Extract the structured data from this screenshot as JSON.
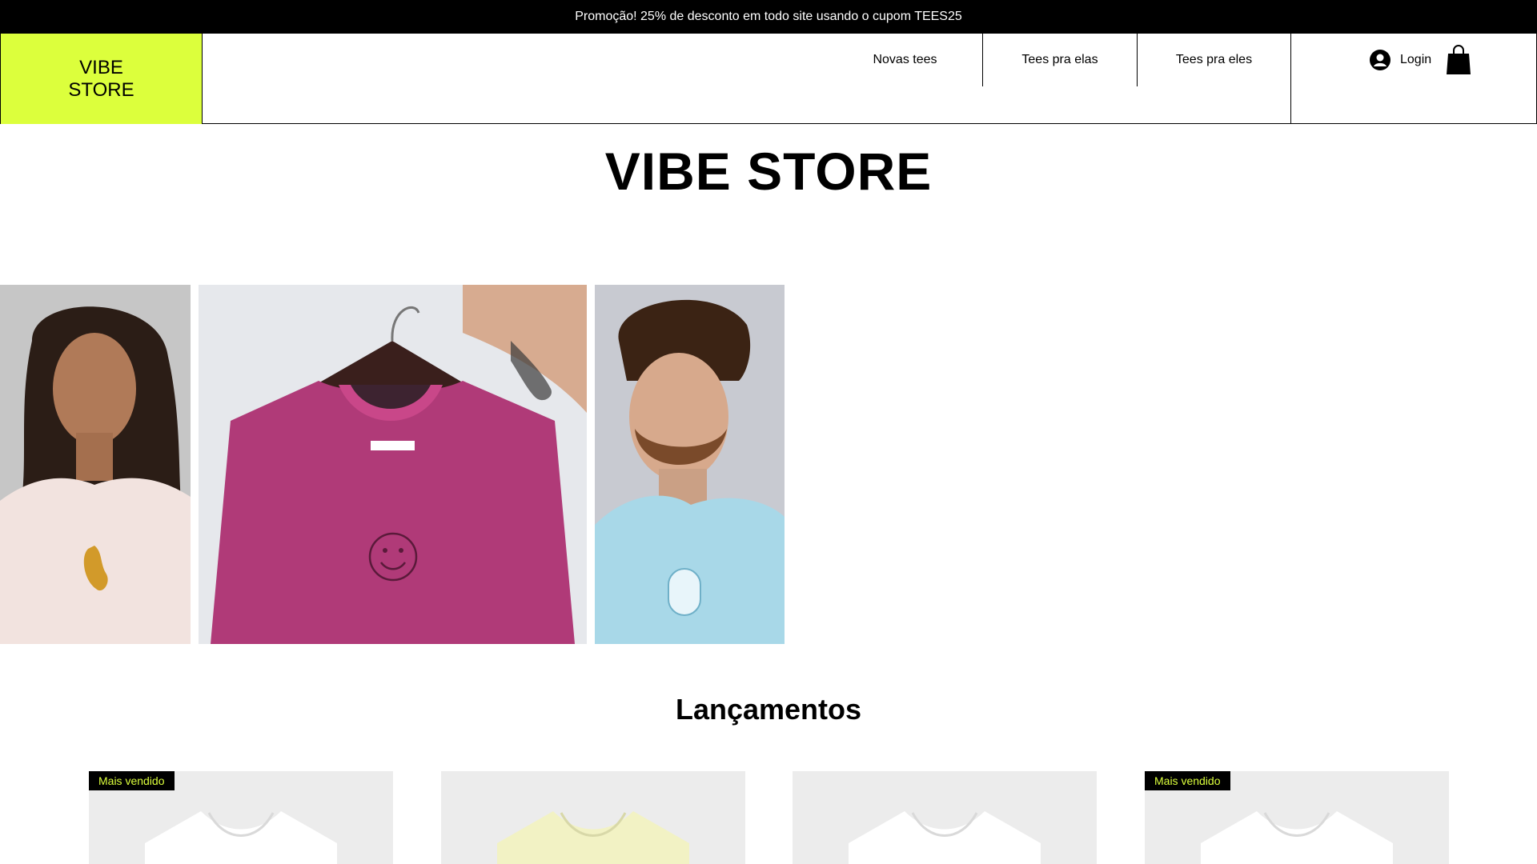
{
  "promo": {
    "text": "Promoção! 25% de desconto em todo site usando o cupom TEES25"
  },
  "header": {
    "logo": "VIBE STORE",
    "nav": [
      "Novas tees",
      "Tees pra elas",
      "Tees pra eles"
    ],
    "login_label": "Login",
    "accent_color": "#dcff3c"
  },
  "hero": {
    "title": "VIBE STORE"
  },
  "gallery": [
    {
      "alt": "woman-in-pink-tee-with-leopard"
    },
    {
      "alt": "pink-smiley-tee-on-hanger"
    },
    {
      "alt": "man-in-blue-tee"
    }
  ],
  "launches": {
    "title": "Lançamentos",
    "products": [
      {
        "badge": "Mais vendido",
        "shirt_color": "#ffffff"
      },
      {
        "badge": "",
        "shirt_color": "#f2f2c4"
      },
      {
        "badge": "",
        "shirt_color": "#ffffff"
      },
      {
        "badge": "Mais vendido",
        "shirt_color": "#ffffff"
      }
    ]
  }
}
